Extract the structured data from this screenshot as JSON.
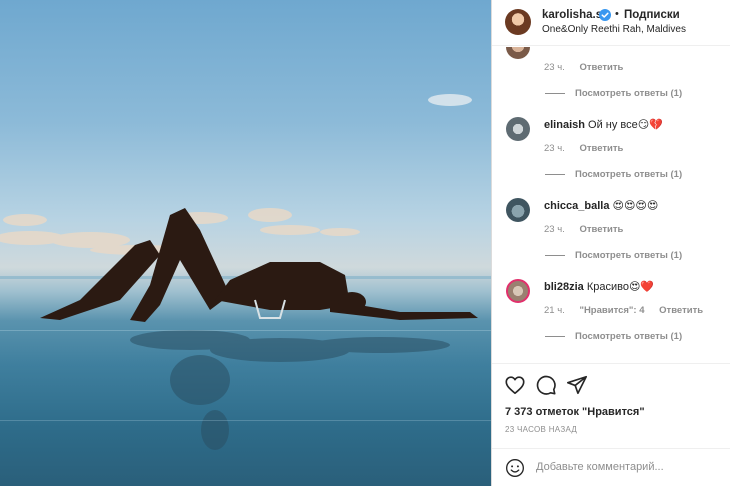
{
  "header": {
    "username": "karolisha.s",
    "separator": "•",
    "follow_label": "Подписки",
    "location": "One&Only Reethi Rah, Maldives"
  },
  "comments": [
    {
      "username": "",
      "text": "",
      "time": "23 ч.",
      "likes": "",
      "reply_label": "Ответить",
      "view_replies": "Посмотреть ответы (1)"
    },
    {
      "username": "elinaish",
      "text": "Ой ну все😏💔",
      "time": "23 ч.",
      "likes": "",
      "reply_label": "Ответить",
      "view_replies": "Посмотреть ответы (1)"
    },
    {
      "username": "chicca_balla",
      "text": "😍😍😍😍",
      "time": "23 ч.",
      "likes": "",
      "reply_label": "Ответить",
      "view_replies": "Посмотреть ответы (1)"
    },
    {
      "username": "bli28zia",
      "text": "Красиво😍❤️",
      "time": "21 ч.",
      "likes": "\"Нравится\": 4",
      "reply_label": "Ответить",
      "view_replies": "Посмотреть ответы (1)"
    }
  ],
  "actions": {
    "icons": [
      "heart-icon",
      "comment-icon",
      "share-icon"
    ],
    "likes_count": "7 373 отметок \"Нравится\"",
    "posted_time": "23 ЧАСОВ НАЗАД"
  },
  "add_comment": {
    "placeholder": "Добавьте комментарий..."
  },
  "colors": {
    "verified": "#3897f0",
    "text": "#262626",
    "muted": "#8e8e8e",
    "border": "#dbdbdb"
  }
}
